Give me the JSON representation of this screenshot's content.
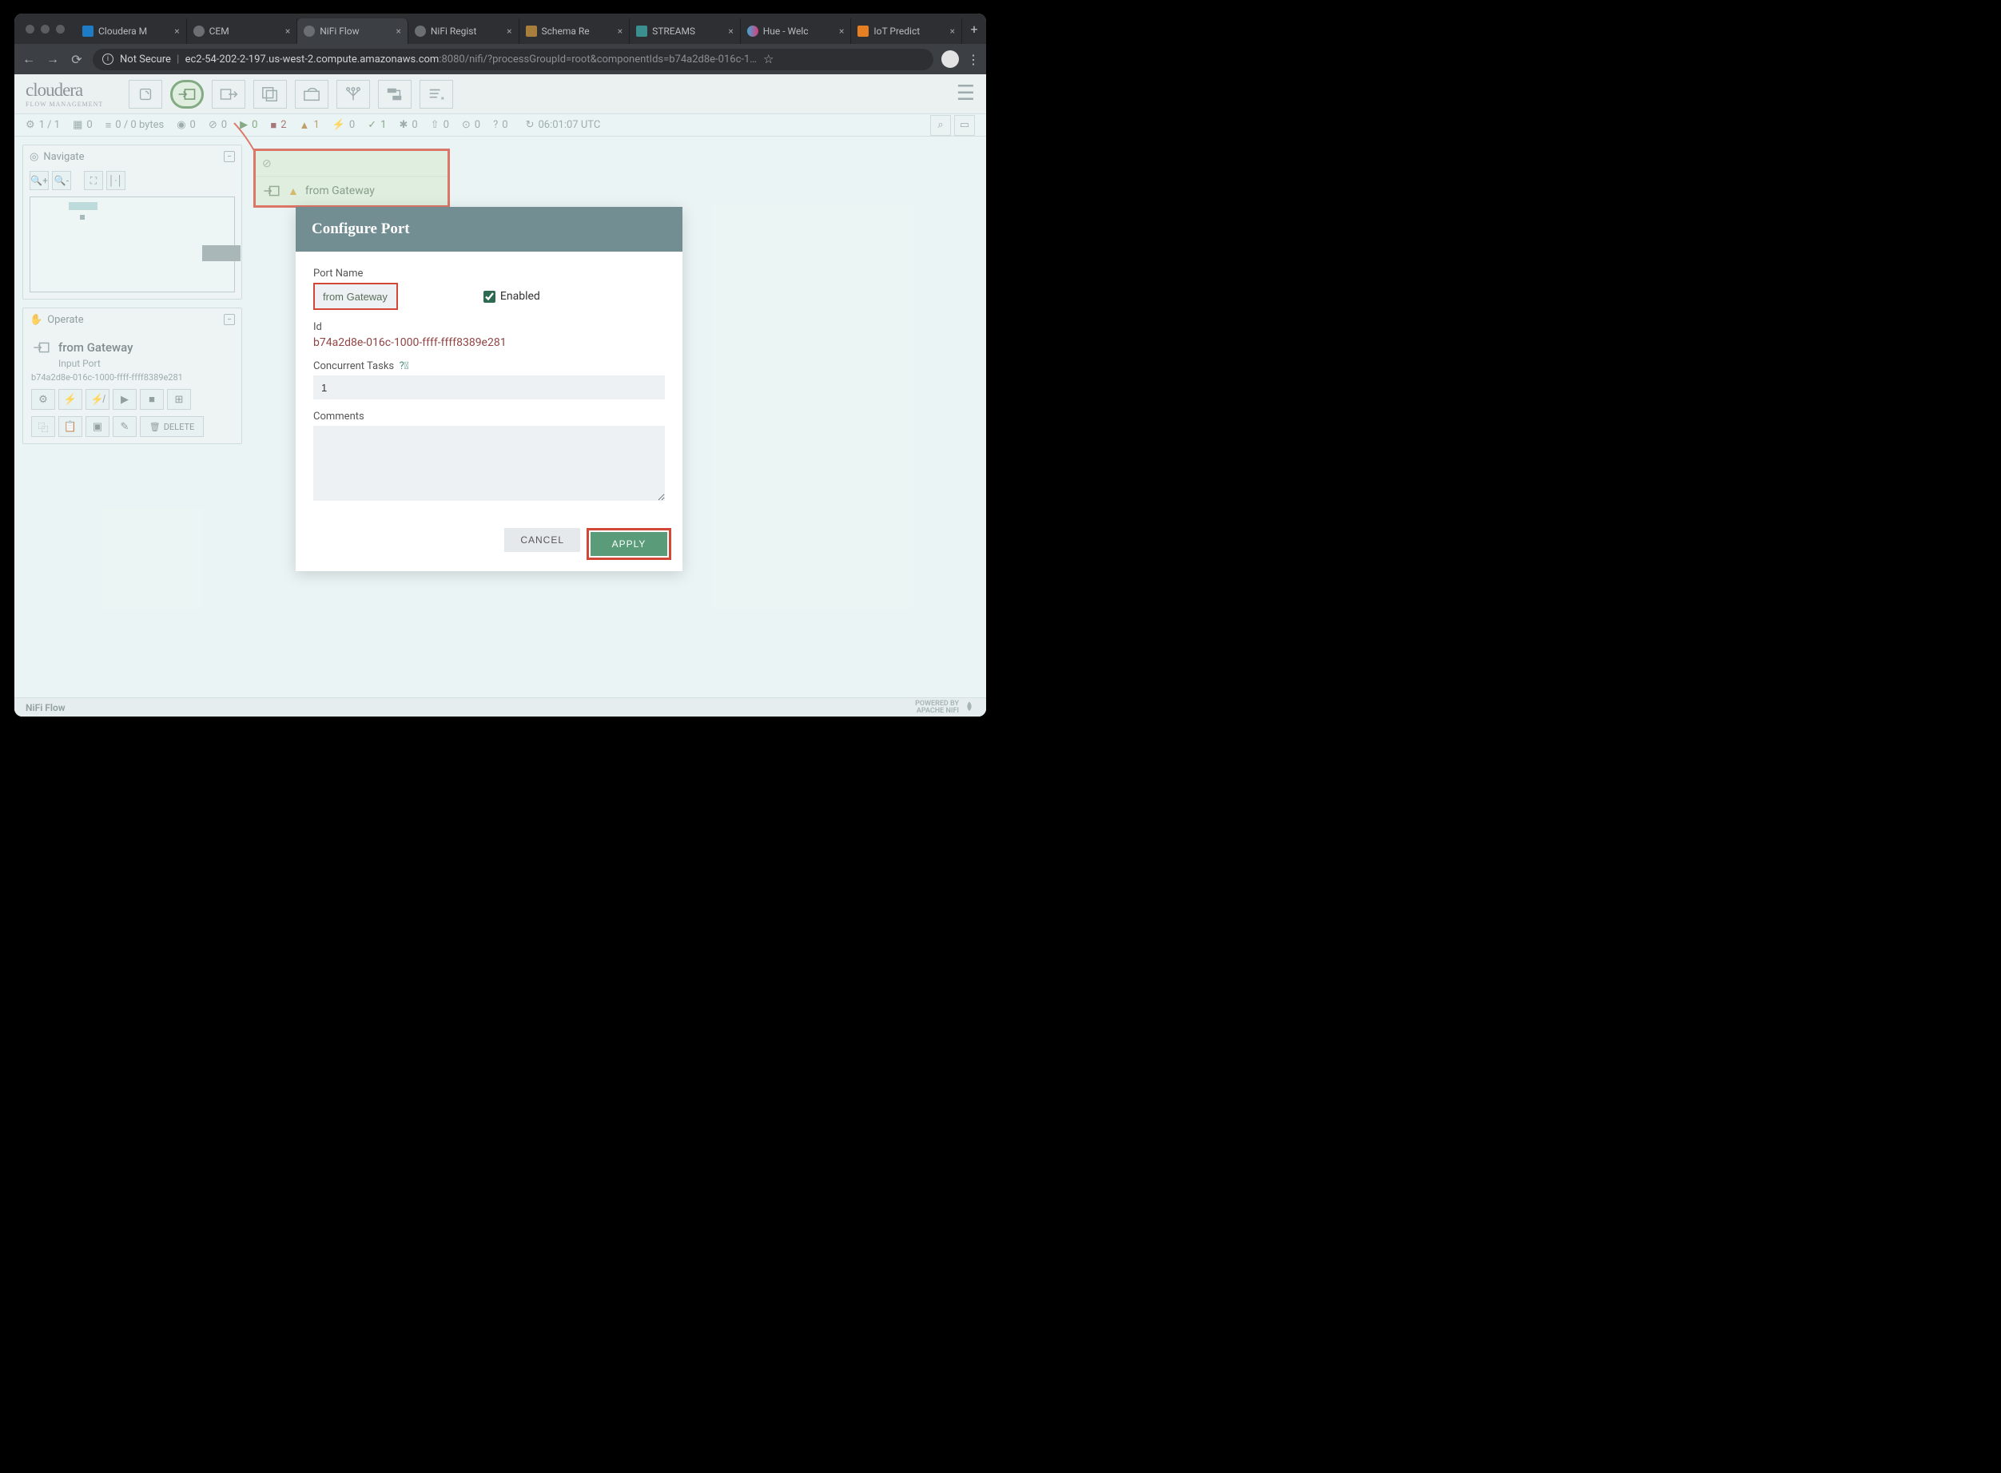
{
  "chrome": {
    "not_secure": "Not Secure",
    "url_host": "ec2-54-202-2-197.us-west-2.compute.amazonaws.com",
    "url_port_path": ":8080/nifi/?processGroupId=root&componentIds=b74a2d8e-016c-1…",
    "tabs": [
      {
        "label": "Cloudera M"
      },
      {
        "label": "CEM"
      },
      {
        "label": "NiFi Flow"
      },
      {
        "label": "NiFi Regist"
      },
      {
        "label": "Schema Re"
      },
      {
        "label": "STREAMS "
      },
      {
        "label": "Hue - Welc"
      },
      {
        "label": "IoT Predict"
      }
    ]
  },
  "brand": {
    "main": "cloudera",
    "sub": "FLOW MANAGEMENT"
  },
  "status": {
    "groups": "1 / 1",
    "queue_threads": "0",
    "queue_bytes": "0 / 0 bytes",
    "transmitting": "0",
    "not_transmitting": "0",
    "running": "0",
    "stopped": "2",
    "invalid": "1",
    "disabled": "0",
    "uptodate": "1",
    "locally_modified": "0",
    "stale": "0",
    "sync_failure": "0",
    "unknown": "0",
    "refresh_time": "06:01:07 UTC"
  },
  "sidebar": {
    "navigate_title": "Navigate",
    "operate_title": "Operate",
    "operate_name": "from Gateway",
    "operate_type": "Input Port",
    "operate_id": "b74a2d8e-016c-1000-ffff-ffff8389e281",
    "delete": "DELETE"
  },
  "canvas": {
    "node_label": "from Gateway"
  },
  "dialog": {
    "title": "Configure Port",
    "port_name_label": "Port Name",
    "port_name_value": "from Gateway",
    "enabled_label": "Enabled",
    "enabled_checked": true,
    "id_label": "Id",
    "id_value": "b74a2d8e-016c-1000-ffff-ffff8389e281",
    "ct_label": "Concurrent Tasks",
    "ct_value": "1",
    "comments_label": "Comments",
    "comments_value": "",
    "cancel": "CANCEL",
    "apply": "APPLY"
  },
  "footer": {
    "breadcrumb": "NiFi Flow",
    "powered_top": "POWERED BY",
    "powered_bottom": "APACHE NIFI"
  }
}
